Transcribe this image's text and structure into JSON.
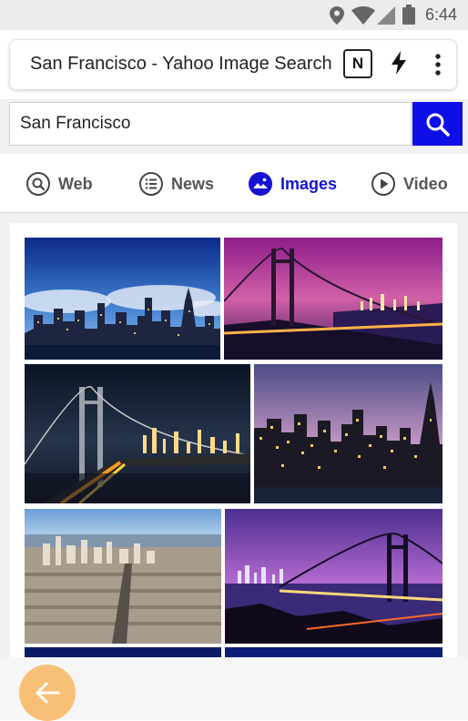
{
  "status_bar": {
    "time": "6:44"
  },
  "browser": {
    "url_text": "San Francisco - Yahoo Image Search",
    "badge_letter": "N"
  },
  "search": {
    "query": "San Francisco"
  },
  "tabs": [
    {
      "label": "Web",
      "icon": "search-icon",
      "active": false
    },
    {
      "label": "News",
      "icon": "list-icon",
      "active": false
    },
    {
      "label": "Images",
      "icon": "image-icon",
      "active": true
    },
    {
      "label": "Video",
      "icon": "play-icon",
      "active": false
    }
  ],
  "results": {
    "images": [
      {
        "subject": "skyline-blue-sky"
      },
      {
        "subject": "bay-bridge-purple-sky"
      },
      {
        "subject": "bay-bridge-night"
      },
      {
        "subject": "skyline-dusk"
      },
      {
        "subject": "city-aerial-day"
      },
      {
        "subject": "bay-bridge-twilight"
      }
    ]
  },
  "colors": {
    "accent": "#1414d2",
    "search_button": "#0e0ee8",
    "back_button": "#f8c076"
  }
}
